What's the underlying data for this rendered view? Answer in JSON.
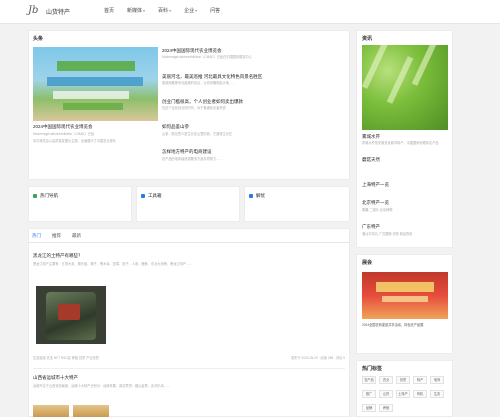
{
  "header": {
    "logo_text": "Jb",
    "site_name": "山货特产",
    "nav": [
      {
        "label": "首页",
        "has_caret": false
      },
      {
        "label": "新媒体",
        "has_caret": true
      },
      {
        "label": "百科",
        "has_caret": true
      },
      {
        "label": "企业",
        "has_caret": true
      },
      {
        "label": "问答",
        "has_caret": false
      }
    ]
  },
  "headlines": {
    "section_title": "头条",
    "hero": {
      "caption": "2024中国国际现代农业博览会",
      "desc_lines": [
        "Modernagricultureexhibition（CMAE）已经",
        "本次博览会以高质量发展为主题，全面展示了中国农业现代"
      ]
    },
    "list": [
      {
        "title": "2024中国国际现代农业博览会",
        "desc": "Modernagricultureexhibition（CMAE）已经在中国国际展览中心"
      },
      {
        "title": "美丽河北，最美巡推 河北最具文化特色风景名胜区",
        "desc": "旅游网推荐河北最美的景点，让你领略燕赵大地……"
      },
      {
        "title": "创业门槛很高，个人创业者如何卖出爆款",
        "desc": "在这个全民创业的时代，对于普通创业者来说"
      },
      {
        "title": "如何品鉴山参",
        "desc": "山参，顾名思义是生长在山里的参。它通常生长在"
      },
      {
        "title": "怎样地方特产的电商建设",
        "desc": "农产品的电商建设需要多方面共同努力……"
      }
    ]
  },
  "news_side": {
    "section_title": "资讯",
    "items": [
      {
        "title": "雾城水芹",
        "desc": "雾城水芹是安徽省宣城市特产，中国国家地理标志产品"
      },
      {
        "title": "蘑菇天然",
        "desc": ""
      },
      {
        "title": "上海特产一览",
        "desc": ""
      },
      {
        "title": "北京特产一览",
        "desc": "果脯 二锅头 北京烤鸭"
      },
      {
        "title": "广东特产",
        "desc": "潮汕牛肉丸 广式腊肠 凉茶 新会陈皮"
      }
    ]
  },
  "quick_nav": [
    {
      "label": "热门导航",
      "color": "#3aa655"
    },
    {
      "label": "工具箱",
      "color": "#2a7ae2"
    },
    {
      "label": "解忧",
      "color": "#2a7ae2"
    }
  ],
  "tabs": {
    "items": [
      "热门",
      "推荐",
      "最新"
    ],
    "active_index": 0
  },
  "articles": [
    {
      "title": "黑龙江的土特产有哪些？",
      "desc": "黑龙江特产主要有：五常大米、猴头菇、榛子、黑木耳、蓝莓、松子、人参、鹿茸、东北大米等；黑龙江特产……",
      "tags": "生态建设  农业  NFT  RSC区  养殖  扶贫  产业扶贫",
      "meta": "发布于 2024-05-20 · 阅读 285 · 评论 0"
    },
    {
      "title": "山西省运城市十大特产",
      "desc": "运城市位于山西省西南部，运城十大特产分别为：运城苹果、闻喜煮饼、稷山板枣、永济扒鸡……",
      "tags": "",
      "meta": ""
    }
  ],
  "ad": {
    "section_title": "展会",
    "caption": "2024全国农商渠道共享活动，特色农产品展"
  },
  "tag_cloud": {
    "section_title": "热门标签",
    "tags": [
      "农产品",
      "农业",
      "扶贫",
      "特产",
      "电商",
      "推广",
      "山货",
      "土特产",
      "有机",
      "生态",
      "品牌",
      "养殖"
    ]
  },
  "colors": {
    "accent": "#2a7ae2",
    "green": "#3aa655",
    "page_bg": "#f2f2f2"
  }
}
